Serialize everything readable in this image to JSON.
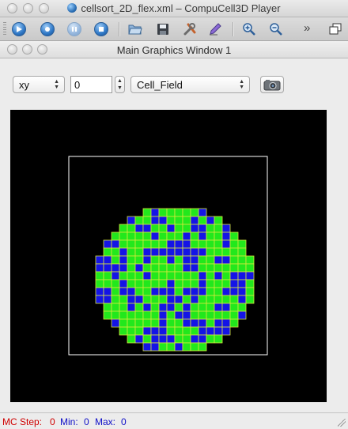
{
  "window": {
    "title": "cellsort_2D_flex.xml – CompuCell3D Player"
  },
  "toolbar": {
    "buttons": [
      "run-icon",
      "step-icon",
      "pause-icon",
      "stop-icon",
      "open-icon",
      "save-icon",
      "tools-icon",
      "edit-icon",
      "zoom-in-icon",
      "zoom-out-icon"
    ],
    "more_label": "»"
  },
  "graphics_window": {
    "title": "Main Graphics Window 1"
  },
  "controls": {
    "plane": "xy",
    "position": "0",
    "field": "Cell_Field"
  },
  "colors": {
    "cell_type_1": "#1414e6",
    "cell_type_2": "#22e81c",
    "membrane": "#d8e63c",
    "background": "#000000",
    "box": "#ffffff"
  },
  "status": {
    "step_label": "MC Step:",
    "step_value": "0",
    "min_label": "Min:",
    "min_value": "0",
    "max_label": "Max:",
    "max_value": "0"
  }
}
